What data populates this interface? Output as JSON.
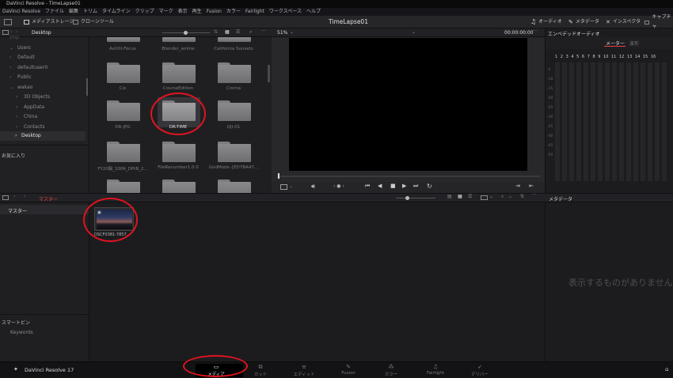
{
  "titlebar": {
    "title": "DaVinci Resolve - TimeLapse01"
  },
  "menubar": {
    "items": [
      "DaVinci Resolve",
      "ファイル",
      "編集",
      "トリム",
      "タイムライン",
      "クリップ",
      "マーク",
      "表示",
      "再生",
      "Fusion",
      "カラー",
      "Fairlight",
      "ワークスペース",
      "ヘルプ"
    ]
  },
  "toolbar": {
    "media_storage": "メディアストレージ",
    "clone_tool": "クローンツール",
    "project_title": "TimeLapse01",
    "audio": "オーディオ",
    "metadata": "メタデータ",
    "inspector": "インスペクタ",
    "capture": "キャプチャ"
  },
  "subbar": {
    "location": "Desktop",
    "zoom": "51%",
    "timecode": "00:00:00:00",
    "embedded_audio": "エンベデッドオーディオ"
  },
  "tree": {
    "partial": "tmp",
    "items": [
      "Users",
      "Default",
      "defaultuser0",
      "Public",
      "wakao",
      "3D Objects",
      "AppData",
      "China",
      "Contacts",
      "Desktop"
    ],
    "favorites": "お気に入り"
  },
  "folders": {
    "row1": [
      "AviUtl-Focus",
      "Blender_anime",
      "California Sunsets"
    ],
    "row2": [
      "Cix",
      "CourseEdition",
      "Croma"
    ],
    "row3": [
      "DR-JPG",
      "DR-TIME",
      "DJI-01"
    ],
    "row4": [
      "FY20脳_SSPA_DPtB_2...",
      "FileRenumber1.0.0",
      "GodMode.{ED7BA47..."
    ]
  },
  "audio": {
    "tab_meter": "メーター",
    "tab_waveform": "波形",
    "channels": [
      "1",
      "2",
      "3",
      "4",
      "5",
      "6",
      "7",
      "8",
      "9",
      "10",
      "11",
      "12",
      "13",
      "14",
      "15",
      "16"
    ],
    "scale": [
      "-5",
      "-10",
      "-15",
      "-20",
      "-25",
      "-30",
      "-35",
      "-40",
      "-45",
      "-50"
    ]
  },
  "midbar": {
    "crumb": "マスター",
    "metadata": "メタデータ"
  },
  "bottomleft": {
    "master": "マスター",
    "smartbin": "スマートビン",
    "keywords": "Keywords"
  },
  "clip": {
    "name": "DSCF0381-7857..."
  },
  "metapanel": {
    "empty": "表示するものがありません"
  },
  "pages": [
    "メディア",
    "カット",
    "エディット",
    "Fusion",
    "カラー",
    "Fairlight",
    "デリバー"
  ],
  "brand": {
    "name": "DaVinci Resolve 17"
  },
  "colors": {
    "accent_red": "#e0141e",
    "tab_active": "#e54444"
  }
}
